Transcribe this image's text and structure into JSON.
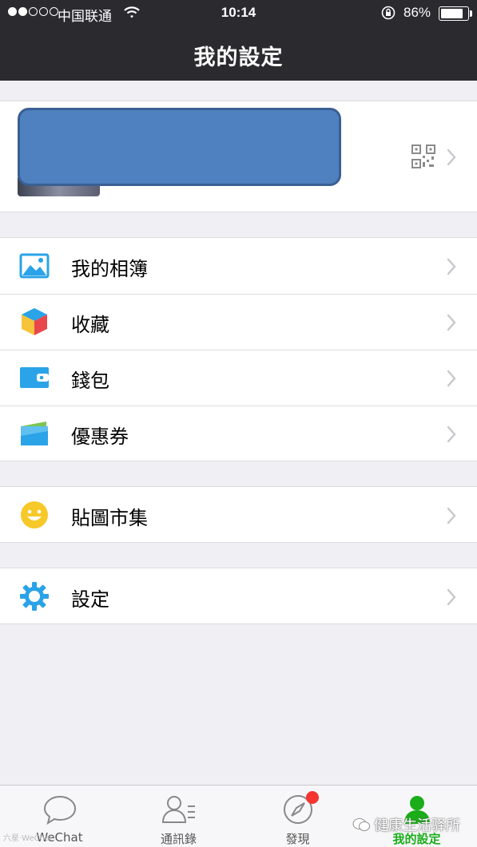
{
  "status_bar": {
    "carrier": "中国联通",
    "time": "10:14",
    "battery": "86%",
    "battery_level": 0.86
  },
  "nav": {
    "title": "我的設定"
  },
  "profile": {
    "qr_icon": "qr-code-icon"
  },
  "menu": {
    "group1": [
      {
        "label": "我的相簿",
        "icon": "photo-album-icon"
      },
      {
        "label": "收藏",
        "icon": "favorites-cube-icon"
      },
      {
        "label": "錢包",
        "icon": "wallet-icon"
      },
      {
        "label": "優惠券",
        "icon": "coupon-icon"
      }
    ],
    "group2": [
      {
        "label": "貼圖市集",
        "icon": "sticker-smiley-icon"
      }
    ],
    "group3": [
      {
        "label": "設定",
        "icon": "settings-gear-icon"
      }
    ]
  },
  "tabs": [
    {
      "label": "WeChat",
      "icon": "chat-bubble-icon"
    },
    {
      "label": "通訊錄",
      "icon": "contacts-icon"
    },
    {
      "label": "發現",
      "icon": "compass-icon",
      "badge": true
    },
    {
      "label": "我的設定",
      "icon": "me-person-icon",
      "active": true
    }
  ],
  "watermark": {
    "left": "六星·WeChat",
    "right": "健康生活驿所"
  },
  "colors": {
    "topbar": "#2b2a2f",
    "accent_green": "#1aad19",
    "badge_red": "#f43530",
    "icon_blue": "#2aa3e8",
    "redact_blue": "#4f80c0"
  }
}
